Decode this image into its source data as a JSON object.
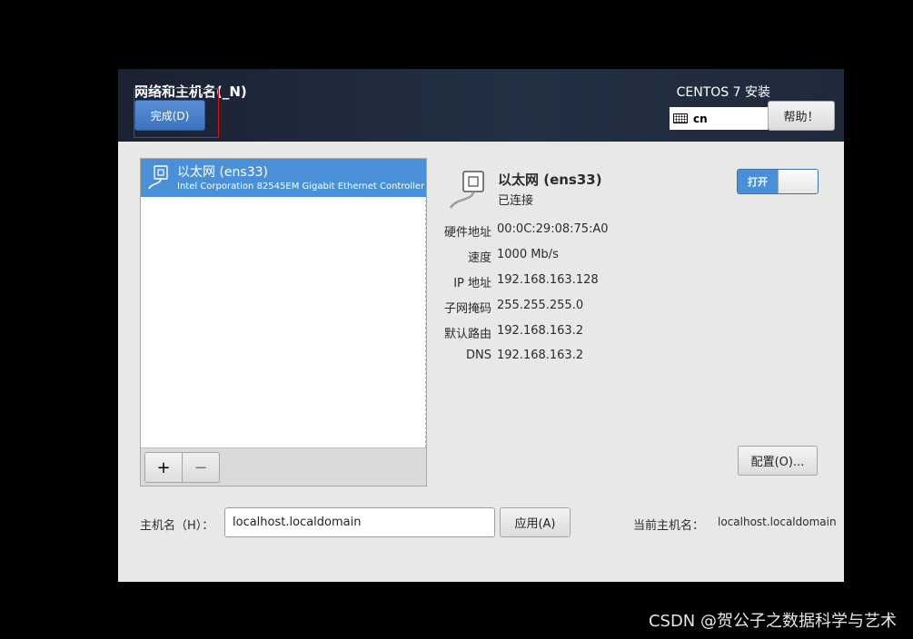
{
  "header": {
    "page_title": "网络和主机名(_N)",
    "done_label": "完成(D)",
    "product_title": "CENTOS 7 安装",
    "keyboard_layout": "cn",
    "help_label": "帮助！"
  },
  "connection_list": {
    "items": [
      {
        "name": "以太网 (ens33)",
        "description": "Intel Corporation 82545EM Gigabit Ethernet Controller (C",
        "icon": "ethernet-icon",
        "selected": true
      }
    ],
    "add_label": "+",
    "remove_label": "−"
  },
  "detail": {
    "name": "以太网 (ens33)",
    "status": "已连接",
    "icon": "ethernet-icon",
    "switch_label": "打开",
    "switch_on": true,
    "properties": [
      {
        "label": "硬件地址",
        "value": "00:0C:29:08:75:A0"
      },
      {
        "label": "速度",
        "value": "1000 Mb/s"
      },
      {
        "label": "IP 地址",
        "value": "192.168.163.128"
      },
      {
        "label": "子网掩码",
        "value": "255.255.255.0"
      },
      {
        "label": "默认路由",
        "value": "192.168.163.2"
      },
      {
        "label": "DNS",
        "value": "192.168.163.2"
      }
    ],
    "config_label": "配置(O)..."
  },
  "hostname": {
    "label": "主机名（H）：",
    "value": "localhost.localdomain",
    "apply_label": "应用(A)",
    "current_label": "当前主机名：",
    "current_value": "localhost.localdomain"
  },
  "colors": {
    "accent": "#4a90d9",
    "header_bg": "#1f2a3b",
    "highlight_box": "#e01010"
  },
  "watermark": "CSDN @贺公子之数据科学与艺术"
}
